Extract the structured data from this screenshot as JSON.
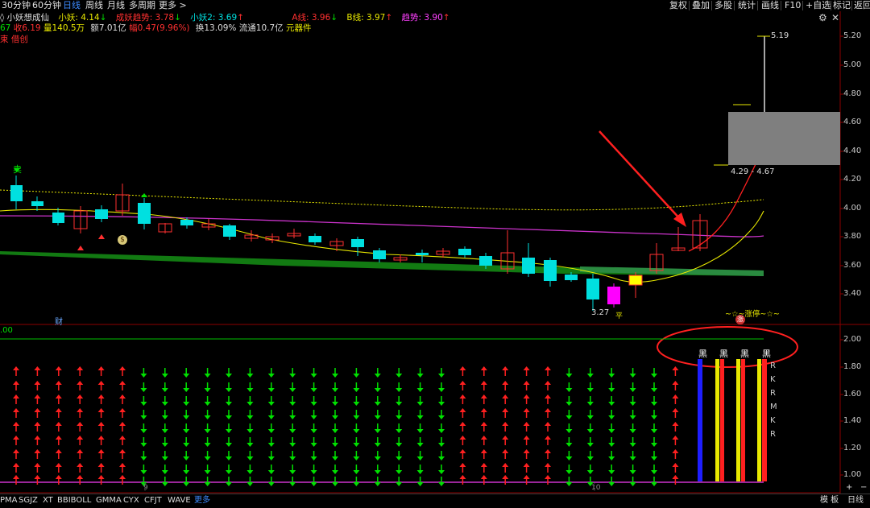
{
  "toolbar": {
    "periods": [
      "30分钟",
      "60分钟",
      "日线",
      "周线",
      "月线",
      "多周期",
      "更多 >"
    ],
    "active_period": "日线",
    "right_buttons": [
      "复权",
      "叠加",
      "多股",
      "统计",
      "画线",
      "F10",
      "+自选",
      "返回"
    ],
    "gear_icon": "gear-icon",
    "close_icon": "close-icon"
  },
  "indicator_line": {
    "name": "小妖想成仙",
    "items": [
      {
        "label": "小妖: 4.14",
        "arrow": "↓",
        "color": "#e8e800"
      },
      {
        "label": "成妖趋势: 3.78",
        "arrow": "↓",
        "color": "#ff3030"
      },
      {
        "label": "小妖2: 3.69",
        "arrow": "↑",
        "color": "#00e0e0"
      },
      {
        "label": "A线: 3.96",
        "arrow": "↓",
        "color": "#ff3030"
      },
      {
        "label": "B线: 3.97",
        "arrow": "↑",
        "color": "#e8e800"
      },
      {
        "label": "趋势: 3.90",
        "arrow": "↑",
        "color": "#ff40ff"
      }
    ]
  },
  "quote_line": {
    "items": [
      {
        "text": "67",
        "color": "#00e000"
      },
      {
        "text": "收6.19",
        "color": "#ff3030"
      },
      {
        "text": "量140.5万",
        "color": "#e8e800"
      },
      {
        "text": "额7.01亿",
        "color": "#dddddd"
      },
      {
        "text": "幅0.47(9.96%)",
        "color": "#ff3030"
      },
      {
        "text": "换13.09%",
        "color": "#dddddd"
      },
      {
        "text": "流通10.7亿",
        "color": "#dddddd"
      },
      {
        "text": "元器件",
        "color": "#e8e800"
      }
    ]
  },
  "tag_line": "束 借创",
  "price_axis": [
    "5.20",
    "5.00",
    "4.80",
    "4.60",
    "4.40",
    "4.20",
    "4.00",
    "3.80",
    "3.60",
    "3.40"
  ],
  "sub_axis": [
    "2.00",
    "1.80",
    "1.60",
    "1.40",
    "1.20",
    "1.00"
  ],
  "sub_left_value": ".00",
  "annotations": {
    "sell": "卖",
    "cai": "财",
    "high_price": "5.19",
    "low_price": "3.27",
    "box_range": "4.29 - 4.67",
    "zhangting": "~☆~涨停~☆~",
    "zhang": "涨",
    "yuan_mark": "$",
    "ping": "平"
  },
  "black_labels": [
    "黑",
    "黑",
    "黑",
    "黑"
  ],
  "side_letters": [
    "R",
    "K",
    "R",
    "M",
    "K",
    "R"
  ],
  "date_labels": [
    "9",
    "10"
  ],
  "bottom_tabs": [
    "PMA",
    "SGJZ",
    "XT",
    "BBIBOLL",
    "GMMA",
    "CYX",
    "CFJT",
    "WAVE",
    "更多"
  ],
  "bottom_right": [
    "模 板",
    "+",
    "−",
    "日线"
  ]
}
